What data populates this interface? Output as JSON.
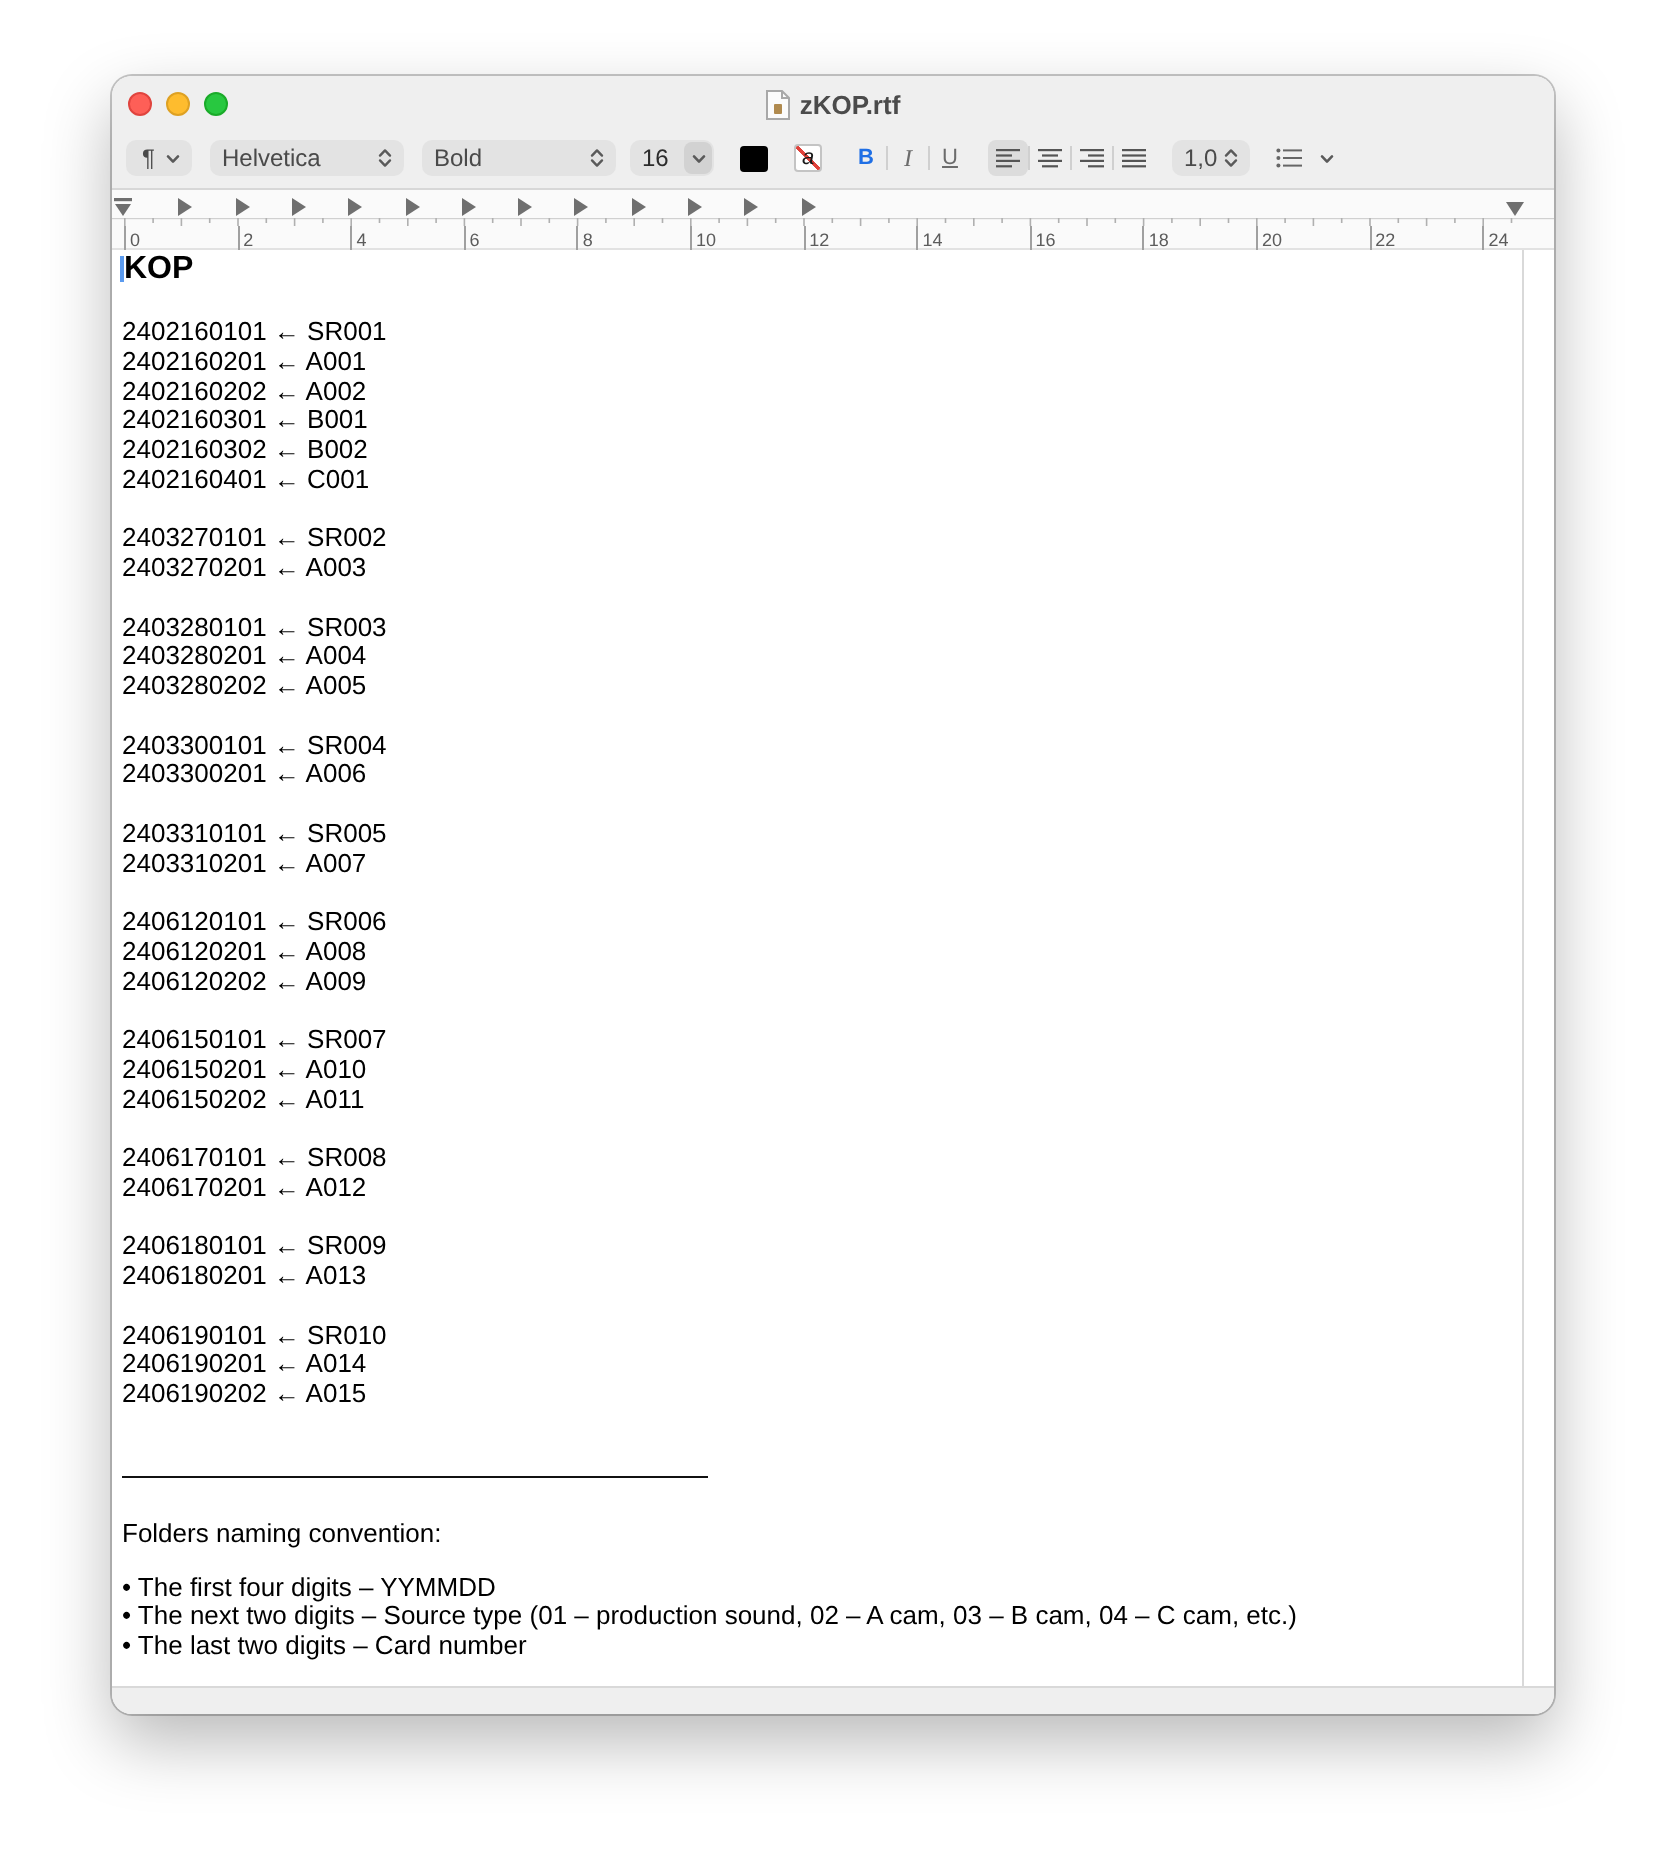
{
  "window": {
    "title": "zKOP.rtf"
  },
  "toolbar": {
    "paragraph_style": "¶",
    "font_family": "Helvetica",
    "typeface": "Bold",
    "font_size": "16",
    "highlight": "a",
    "styles": [
      {
        "kind": "bold",
        "label": "B",
        "on": true
      },
      {
        "kind": "italic",
        "label": "I",
        "on": false
      },
      {
        "kind": "underline",
        "label": "U",
        "on": false
      }
    ],
    "alignment": [
      {
        "kind": "left",
        "selected": true
      },
      {
        "kind": "center",
        "selected": false
      },
      {
        "kind": "right",
        "selected": false
      },
      {
        "kind": "justify",
        "selected": false
      }
    ],
    "line_spacing": "1,0"
  },
  "ruler": {
    "labels": [
      "0",
      "2",
      "4",
      "6",
      "8",
      "10",
      "12",
      "14",
      "16",
      "18",
      "20",
      "22",
      "24"
    ],
    "tab_stops": [
      {
        "kind": "left"
      },
      {
        "kind": "left"
      },
      {
        "kind": "left"
      },
      {
        "kind": "left"
      },
      {
        "kind": "left"
      },
      {
        "kind": "left"
      },
      {
        "kind": "left"
      },
      {
        "kind": "left"
      },
      {
        "kind": "left"
      },
      {
        "kind": "left"
      },
      {
        "kind": "left"
      },
      {
        "kind": "left"
      }
    ]
  },
  "document": {
    "heading": "KOP",
    "groups": [
      {
        "lines": [
          "2402160101 ← SR001",
          "2402160201 ← A001",
          "2402160202 ← A002",
          "2402160301 ← B001",
          "2402160302 ← B002",
          "2402160401 ← C001"
        ]
      },
      {
        "lines": [
          "2403270101 ← SR002",
          "2403270201 ← A003"
        ]
      },
      {
        "lines": [
          "2403280101 ← SR003",
          "2403280201 ← A004",
          "2403280202 ← A005"
        ]
      },
      {
        "lines": [
          "2403300101 ← SR004",
          "2403300201 ← A006"
        ]
      },
      {
        "lines": [
          "2403310101 ← SR005",
          "2403310201 ← A007"
        ]
      },
      {
        "lines": [
          "2406120101 ← SR006",
          "2406120201 ← A008",
          "2406120202 ← A009"
        ]
      },
      {
        "lines": [
          "2406150101 ← SR007",
          "2406150201 ← A010",
          "2406150202 ← A011"
        ]
      },
      {
        "lines": [
          "2406170101 ← SR008",
          "2406170201 ← A012"
        ]
      },
      {
        "lines": [
          "2406180101 ← SR009",
          "2406180201 ← A013"
        ]
      },
      {
        "lines": [
          "2406190101 ← SR010",
          "2406190201 ← A014",
          "2406190202 ← A015"
        ]
      }
    ],
    "separator": true,
    "note": "Folders naming convention:",
    "bullets": [
      "• The first four digits – YYMMDD",
      "• The next two digits – Source type (01 – production sound, 02 – A cam, 03 – B cam, 04 – C cam, etc.)",
      "• The last two digits – Card number"
    ]
  }
}
